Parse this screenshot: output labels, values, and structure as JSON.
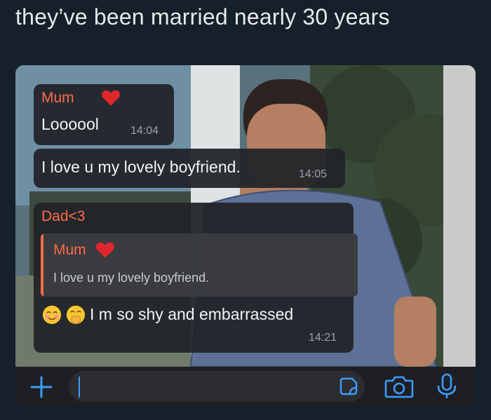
{
  "post": {
    "caption": "they’ve been married nearly 30 years"
  },
  "chat": {
    "messages": [
      {
        "sender": "Mum",
        "text": "Loooool",
        "time": "14:04"
      },
      {
        "sender": "",
        "text": "I love u my lovely boyfriend.",
        "time": "14:05"
      },
      {
        "sender": "Dad<3",
        "quoted": {
          "sender": "Mum",
          "text": "I love u my lovely boyfriend."
        },
        "text": "I m so shy and embarrassed",
        "time": "14:21"
      }
    ]
  },
  "composer": {
    "input_value": ""
  },
  "colors": {
    "sender_name": "#ff6b4a",
    "quote_bar": "#f26f45",
    "accent_icon": "#3b9cff",
    "heart": "#e0262d"
  },
  "icons": [
    "heart-emoji-icon",
    "plus-icon",
    "sticker-icon",
    "camera-icon",
    "microphone-icon",
    "smiling-blush-emoji-icon",
    "hand-over-mouth-emoji-icon"
  ]
}
